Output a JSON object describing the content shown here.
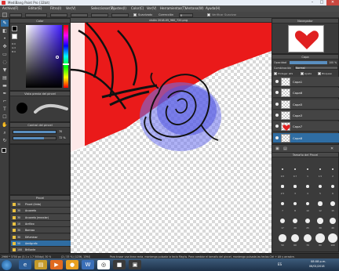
{
  "window": {
    "title": "MediBang Paint Pro (32bit)",
    "minimize": "–",
    "maximize": "□",
    "close": "✕"
  },
  "menu": [
    "Archivo(F)",
    "Editar(E)",
    "Filtro(I)",
    "Ver(V)",
    "Seleccionar(S)",
    "Ajustes(I)",
    "Color(C)",
    "Ver(V)",
    "Herramientas(T)",
    "Ventana(W)",
    "Ayuda(H)"
  ],
  "tool_options": {
    "suavizado_label": "Suavizado",
    "correccion_label": "Corrección",
    "correccion_value": "0",
    "neutral_label": "Verificar Suavizar"
  },
  "tools": [
    {
      "icon": "brush-icon",
      "glyph": "✎",
      "active": true
    },
    {
      "icon": "eraser-icon",
      "glyph": "◧"
    },
    {
      "icon": "dot-icon",
      "glyph": "•"
    },
    {
      "icon": "move-icon",
      "glyph": "✥"
    },
    {
      "icon": "rect-select-icon",
      "glyph": "▭"
    },
    {
      "icon": "lasso-icon",
      "glyph": "◌"
    },
    {
      "icon": "fill-icon",
      "glyph": "▼"
    },
    {
      "icon": "gradient-icon",
      "glyph": "▤"
    },
    {
      "icon": "shape-icon",
      "glyph": "▬"
    },
    {
      "icon": "pen-icon",
      "glyph": "✒"
    },
    {
      "icon": "dropper-icon",
      "glyph": "⌐"
    },
    {
      "icon": "text-icon",
      "glyph": "T"
    },
    {
      "icon": "speech-icon",
      "glyph": "☐"
    },
    {
      "icon": "hand-icon",
      "glyph": "✋"
    },
    {
      "icon": "zoom-icon",
      "glyph": "⌕"
    },
    {
      "icon": "rotate-icon",
      "glyph": "↻"
    }
  ],
  "color_panel": {
    "title": "Color",
    "r": "R:0",
    "g": "G:0",
    "b": "B:0"
  },
  "brush_preview_panel": {
    "title": "Vista previa del pincel"
  },
  "brush_control_panel": {
    "title": "Control del pincel",
    "size_value": "70",
    "opacity_value": "72 %"
  },
  "brush_list_panel": {
    "title": "Pincel",
    "items": [
      {
        "size": "30",
        "name": "Pincel (tinta)"
      },
      {
        "size": "30",
        "name": "Acuarela"
      },
      {
        "size": "30",
        "name": "Acuarela (mezclar)"
      },
      {
        "size": "10",
        "name": "Acrílico"
      },
      {
        "size": "30",
        "name": "Borroso"
      },
      {
        "size": "30",
        "name": "Difuminar"
      },
      {
        "size": "50",
        "name": "Aerógrafo",
        "active": true
      },
      {
        "size": "100",
        "name": "Brillante"
      }
    ]
  },
  "document": {
    "tab": "visión 2018-05_960_720.png"
  },
  "navigator_panel": {
    "title": "Navegador"
  },
  "layer_panel": {
    "title": "Capa",
    "opacity_label": "Opacidad",
    "opacity_value": "100 %",
    "blend_label": "Combinación",
    "blend_value": "Normal",
    "protect_alpha": "Proteger alfa",
    "clip": "Ajuste",
    "lock": "Bloquear",
    "layers": [
      {
        "name": "Capa1"
      },
      {
        "name": "Capa6"
      },
      {
        "name": "Capa5"
      },
      {
        "name": "Capa3"
      },
      {
        "name": "Capa7"
      },
      {
        "name": "Capa8",
        "active": true
      }
    ]
  },
  "brush_size_panel": {
    "title": "Tamaño del Pincel",
    "sizes": [
      "0.5",
      "0.7",
      "1",
      "1.5",
      "2",
      "2.5",
      "3",
      "4",
      "5",
      "6",
      "7",
      "8",
      "10",
      "12",
      "15",
      "17",
      "20",
      "25",
      "30",
      "40",
      "50",
      "60",
      "70",
      "80",
      "100"
    ]
  },
  "statusbar": {
    "dimensions": "2966 * 3700 px (3.1 x 1.7 500dpi) 30 %",
    "coords": "(2 / 33 %) (1236, 1394)",
    "hint": "Para trazar una línea recta, mantenga pulsada la tecla Mayús. Para cambiar el tamaño del pincel, mantenga pulsada las teclas Ctrl + Alt y arrastre."
  },
  "taskbar": {
    "time": "08:08 p.m.",
    "date": "06/01/2018",
    "lang": "ES"
  },
  "colors": {
    "accent": "#2f6da3",
    "canvas_red": "#ea1a1a",
    "rose_blue": "#5a5ee6"
  }
}
